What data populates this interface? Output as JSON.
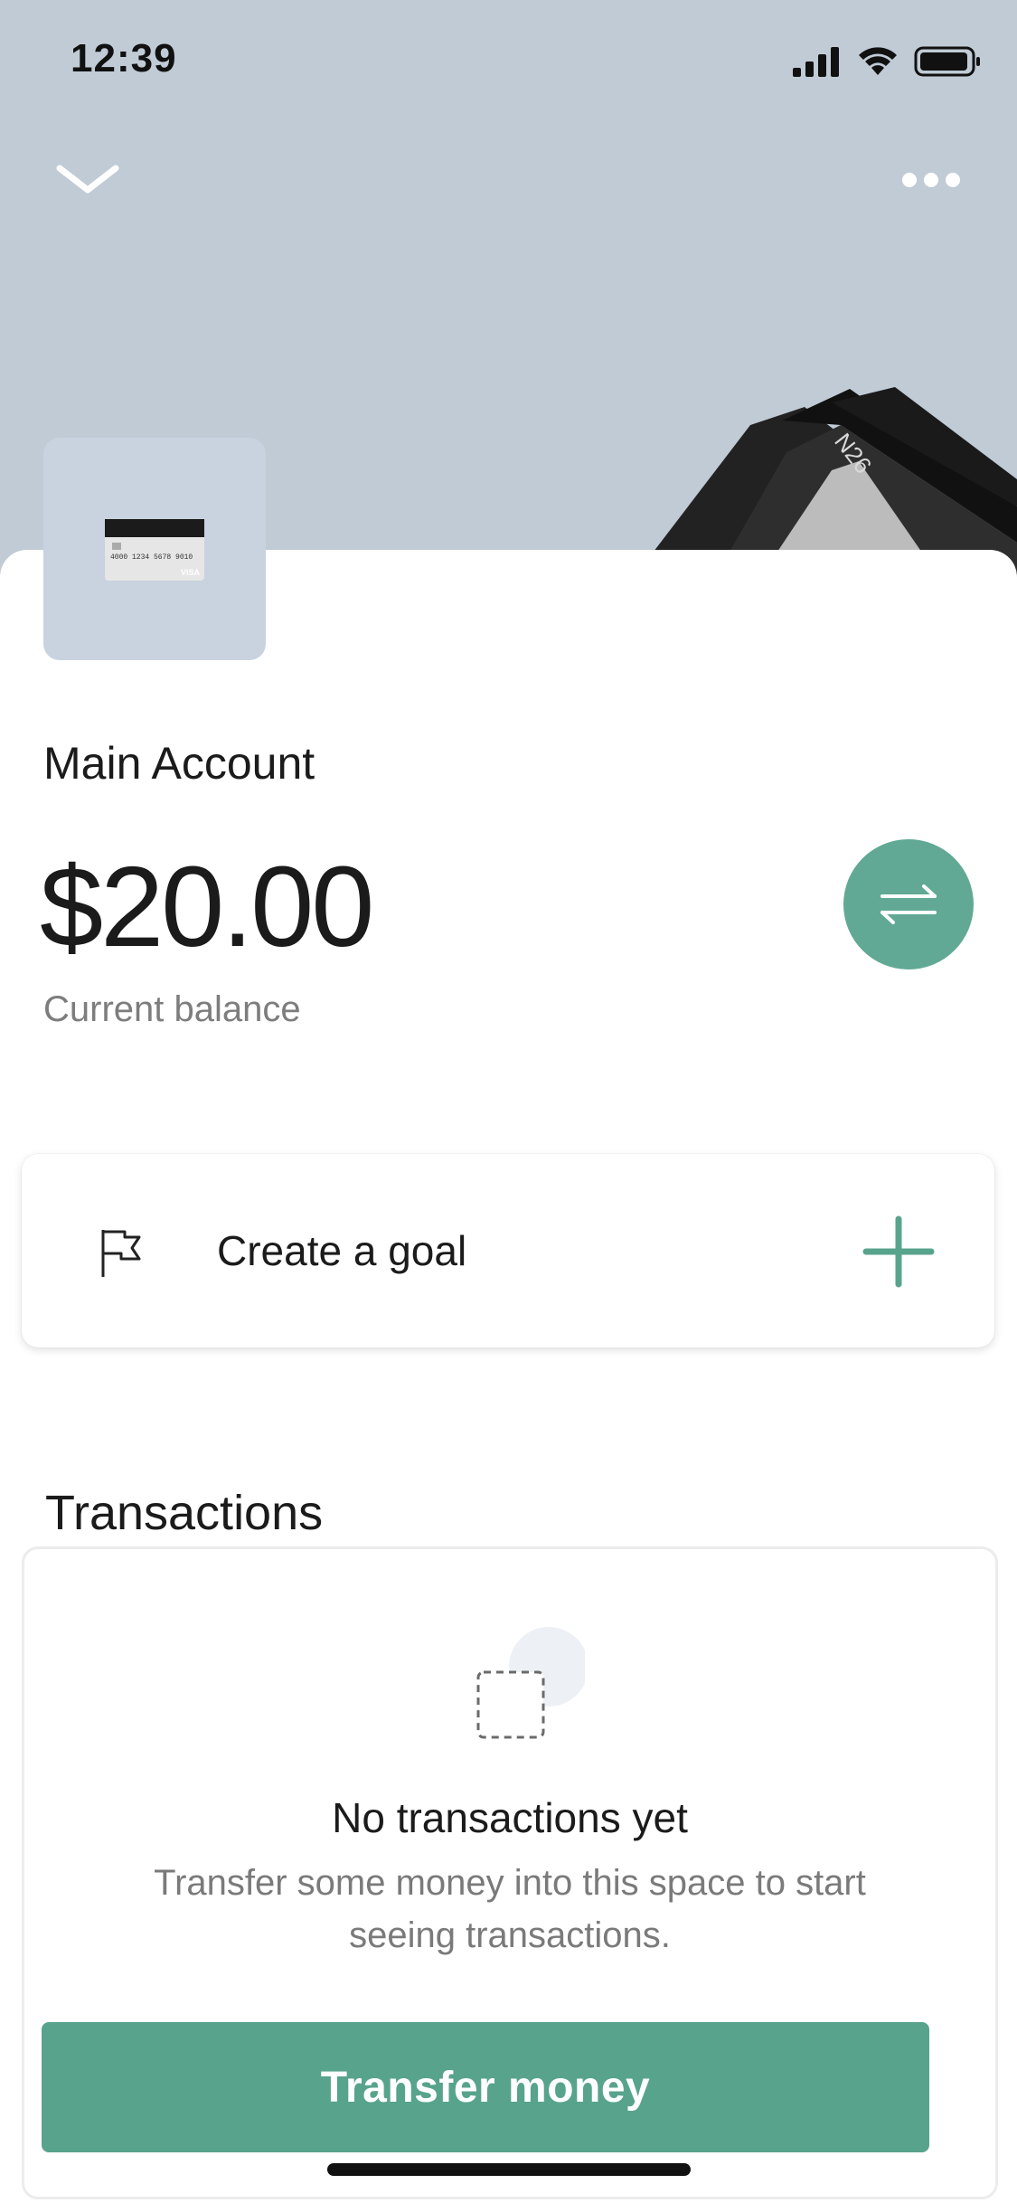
{
  "status_bar": {
    "time": "12:39"
  },
  "header": {
    "back_icon": "chevron-down-icon",
    "menu_icon": "more-horizontal-icon",
    "brand_text_on_image": "N26"
  },
  "account": {
    "name": "Main Account",
    "balance": "$20.00",
    "balance_label": "Current balance",
    "card_number_on_thumb": "4000 1234 5678 9010",
    "card_brand_on_thumb": "VISA"
  },
  "goal": {
    "label": "Create a goal",
    "icon": "flag-icon",
    "action_icon": "plus-icon"
  },
  "transactions": {
    "title": "Transactions",
    "empty_title": "No transactions yet",
    "empty_text": "Transfer some money into this space to start seeing transactions.",
    "button_label": "Transfer money"
  },
  "colors": {
    "hero_bg": "#c0cbd6",
    "accent": "#58a38c",
    "swap_button": "#61a995",
    "muted_text": "#7d7d7d"
  }
}
